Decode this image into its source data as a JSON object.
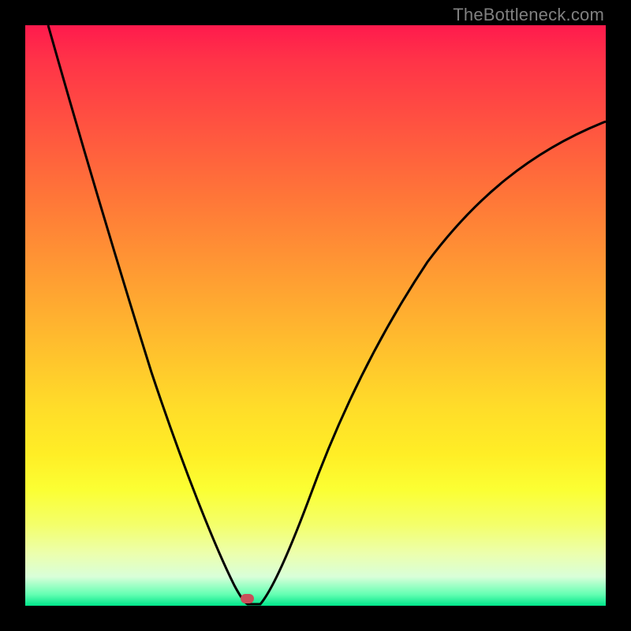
{
  "watermark": "TheBottleneck.com",
  "chart_data": {
    "type": "line",
    "title": "",
    "xlabel": "",
    "ylabel": "",
    "xlim": [
      0,
      100
    ],
    "ylim": [
      0,
      100
    ],
    "series": [
      {
        "name": "bottleneck-curve",
        "x": [
          4,
          8,
          12,
          16,
          20,
          24,
          28,
          32,
          35,
          37,
          38,
          39,
          40,
          42,
          44,
          48,
          52,
          56,
          60,
          65,
          70,
          75,
          80,
          85,
          90,
          95,
          100
        ],
        "y": [
          100,
          88,
          76,
          65,
          54,
          43,
          32,
          21,
          11,
          5,
          2,
          0,
          0,
          3,
          8,
          18,
          27,
          35,
          42,
          50,
          57,
          63,
          68,
          73,
          77,
          80,
          83
        ]
      }
    ],
    "marker": {
      "x": 38.5,
      "y": 0
    },
    "gradient_colors": {
      "top": "#ff1a4d",
      "mid": "#ffdd29",
      "bottom": "#00e68a"
    }
  }
}
